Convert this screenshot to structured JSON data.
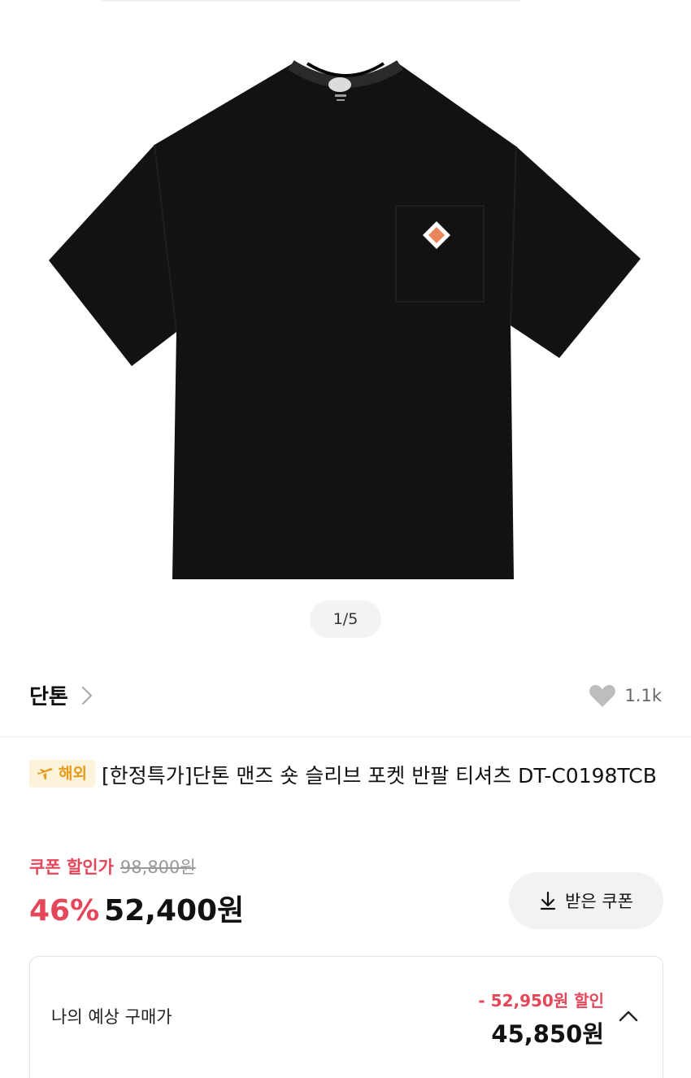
{
  "gallery": {
    "pager": "1/5"
  },
  "brand": {
    "name": "단톤"
  },
  "like": {
    "count": "1.1k"
  },
  "product": {
    "badge": "해외",
    "title": "[한정특가]단톤 맨즈 숏 슬리브 포켓 반팔 티셔츠 DT-C0198TCB"
  },
  "pricing": {
    "coupon_label": "쿠폰 할인가",
    "original_price": "98,800원",
    "discount_rate": "46%",
    "final_price": "52,400원",
    "coupon_button": "받은 쿠폰"
  },
  "estimate": {
    "label": "나의 예상 구매가",
    "discount": "- 52,950원 할인",
    "price": "45,850원"
  },
  "colors": {
    "accent_red": "#e4475a",
    "badge_bg": "#fdf3da",
    "badge_text": "#e89a1a"
  }
}
